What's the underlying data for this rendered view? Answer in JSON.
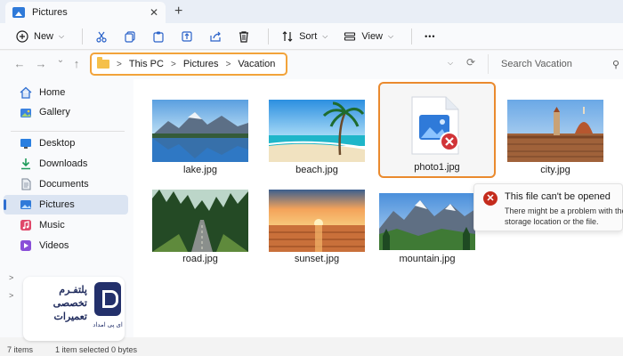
{
  "window": {
    "tab_title": "Pictures",
    "new_tab_glyph": "+",
    "close_glyph": "✕"
  },
  "commandbar": {
    "new_label": "New",
    "sort_label": "Sort",
    "view_label": "View",
    "more_glyph": "•••",
    "icons": [
      "new-icon",
      "cut-icon",
      "copy-icon",
      "paste-icon",
      "rename-icon",
      "share-icon",
      "delete-icon",
      "sort-icon",
      "view-icon"
    ]
  },
  "address": {
    "crumbs": [
      "This PC",
      "Pictures",
      "Vacation"
    ],
    "search_placeholder": "Search Vacation"
  },
  "sidebar": {
    "items": [
      {
        "label": "Home",
        "icon": "home-icon",
        "color": "#2f6fd1"
      },
      {
        "label": "Gallery",
        "icon": "gallery-icon",
        "color": "#3b82e0"
      },
      {
        "label": "Desktop",
        "icon": "desktop-icon",
        "color": "#2a7fe0"
      },
      {
        "label": "Downloads",
        "icon": "downloads-icon",
        "color": "#1e9b5a"
      },
      {
        "label": "Documents",
        "icon": "documents-icon",
        "color": "#7a8796"
      },
      {
        "label": "Pictures",
        "icon": "pictures-icon",
        "color": "#2f7ad9",
        "active": true
      },
      {
        "label": "Music",
        "icon": "music-icon",
        "color": "#e0486a"
      },
      {
        "label": "Videos",
        "icon": "videos-icon",
        "color": "#8a4fd8"
      }
    ]
  },
  "files": [
    {
      "name": "lake.jpg"
    },
    {
      "name": "beach.jpg"
    },
    {
      "name": "photo1.jpg",
      "selected": true,
      "broken": true
    },
    {
      "name": "city.jpg"
    },
    {
      "name": "road.jpg"
    },
    {
      "name": "sunset.jpg"
    },
    {
      "name": "mountain.jpg"
    }
  ],
  "toast": {
    "title": "This file can't be opened",
    "message_line1": "There might be a problem with the",
    "message_line2": "storage location or the file."
  },
  "statusbar": {
    "items": "7 items",
    "selected": "1 item selected  0 bytes"
  },
  "logo": {
    "line1": "پلتفـرم",
    "line2": "تخصصی",
    "line3": "تعمیرات",
    "sub": "ای پی امداد"
  },
  "colors": {
    "accent": "#2f6fd1",
    "highlight_orange": "#ea8a2e",
    "error_red": "#c42b1c"
  }
}
